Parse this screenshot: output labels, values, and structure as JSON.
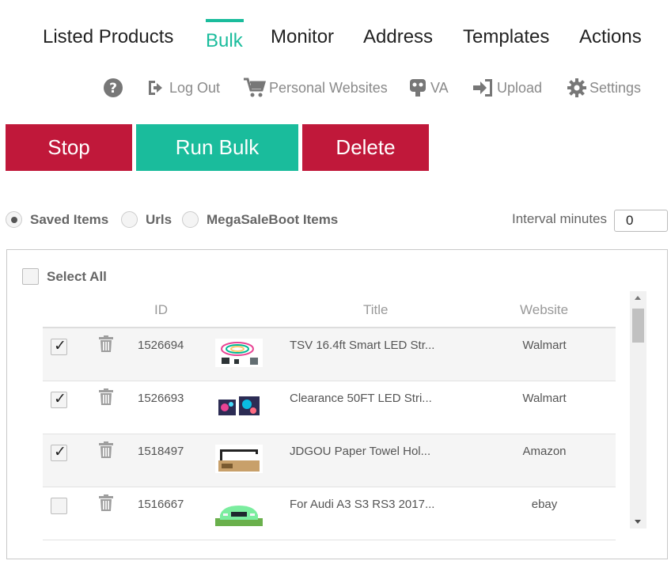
{
  "tabs": {
    "listed_products": "Listed Products",
    "bulk": "Bulk",
    "monitor": "Monitor",
    "address": "Address",
    "templates": "Templates",
    "actions": "Actions",
    "active": "bulk"
  },
  "toolbar": {
    "help_icon": "question-circle-icon",
    "logout": "Log Out",
    "personal_websites": "Personal Websites",
    "va": "VA",
    "upload": "Upload",
    "settings": "Settings"
  },
  "buttons": {
    "stop": "Stop",
    "run_bulk": "Run Bulk",
    "delete": "Delete"
  },
  "source": {
    "saved_items": "Saved Items",
    "urls": "Urls",
    "megasaleboot_items": "MegaSaleBoot Items",
    "selected": "saved_items"
  },
  "interval": {
    "label": "Interval minutes",
    "value": "0"
  },
  "table": {
    "select_all": "Select All",
    "columns": {
      "id": "ID",
      "title": "Title",
      "website": "Website"
    },
    "rows": [
      {
        "checked": true,
        "id": "1526694",
        "title": "TSV 16.4ft Smart LED Str...",
        "website": "Walmart",
        "thumb": "led-strip-kit"
      },
      {
        "checked": true,
        "id": "1526693",
        "title": "Clearance 50FT LED Stri...",
        "website": "Walmart",
        "thumb": "led-strip-lights"
      },
      {
        "checked": true,
        "id": "1518497",
        "title": "JDGOU Paper Towel Hol...",
        "website": "Amazon",
        "thumb": "paper-towel-holder"
      },
      {
        "checked": false,
        "id": "1516667",
        "title": "For Audi A3 S3 RS3 2017...",
        "website": "ebay",
        "thumb": "green-car"
      }
    ]
  },
  "colors": {
    "accent": "#1abc9c",
    "danger": "#c0183a"
  }
}
